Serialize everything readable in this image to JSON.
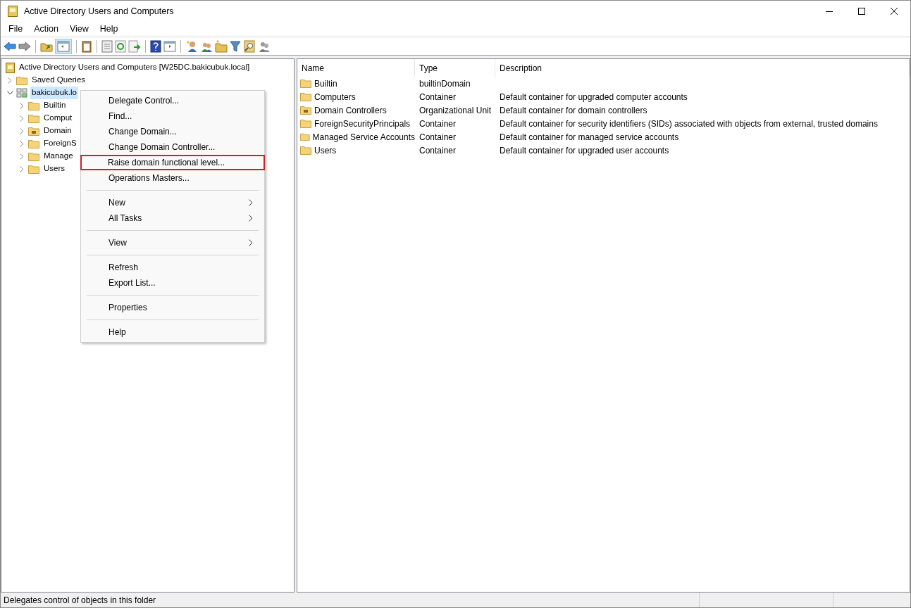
{
  "window": {
    "title": "Active Directory Users and Computers"
  },
  "menu_bar": [
    "File",
    "Action",
    "View",
    "Help"
  ],
  "tree": {
    "label": "Active Directory Users and Computers [W25DC.bakicubuk.local]",
    "children": [
      {
        "label": "Saved Queries",
        "kind": "folder",
        "expanded": false,
        "selected": false
      },
      {
        "label": "bakicubuk.lo",
        "kind": "domain",
        "expanded": true,
        "selected": true,
        "children": [
          {
            "label": "Builtin",
            "kind": "folder",
            "expanded": false,
            "selected": false
          },
          {
            "label": "Comput",
            "kind": "folder",
            "expanded": false,
            "selected": false
          },
          {
            "label": "Domain",
            "kind": "ou",
            "expanded": false,
            "selected": false
          },
          {
            "label": "ForeignS",
            "kind": "folder",
            "expanded": false,
            "selected": false
          },
          {
            "label": "Manage",
            "kind": "folder",
            "expanded": false,
            "selected": false
          },
          {
            "label": "Users",
            "kind": "folder",
            "expanded": false,
            "selected": false
          }
        ]
      }
    ]
  },
  "context_menu": [
    {
      "kind": "item",
      "label": "Delegate Control...",
      "submenu": false,
      "highlighted": false
    },
    {
      "kind": "item",
      "label": "Find...",
      "submenu": false,
      "highlighted": false
    },
    {
      "kind": "item",
      "label": "Change Domain...",
      "submenu": false,
      "highlighted": false
    },
    {
      "kind": "item",
      "label": "Change Domain Controller...",
      "submenu": false,
      "highlighted": false
    },
    {
      "kind": "item",
      "label": "Raise domain functional level...",
      "submenu": false,
      "highlighted": true
    },
    {
      "kind": "item",
      "label": "Operations Masters...",
      "submenu": false,
      "highlighted": false
    },
    {
      "kind": "separator"
    },
    {
      "kind": "item",
      "label": "New",
      "submenu": true,
      "highlighted": false
    },
    {
      "kind": "item",
      "label": "All Tasks",
      "submenu": true,
      "highlighted": false
    },
    {
      "kind": "separator"
    },
    {
      "kind": "item",
      "label": "View",
      "submenu": true,
      "highlighted": false
    },
    {
      "kind": "separator"
    },
    {
      "kind": "item",
      "label": "Refresh",
      "submenu": false,
      "highlighted": false
    },
    {
      "kind": "item",
      "label": "Export List...",
      "submenu": false,
      "highlighted": false
    },
    {
      "kind": "separator"
    },
    {
      "kind": "item",
      "label": "Properties",
      "submenu": false,
      "highlighted": false
    },
    {
      "kind": "separator"
    },
    {
      "kind": "item",
      "label": "Help",
      "submenu": false,
      "highlighted": false
    }
  ],
  "list": {
    "columns": [
      "Name",
      "Type",
      "Description"
    ],
    "rows": [
      {
        "kind": "folder",
        "name": "Builtin",
        "type": "builtinDomain",
        "description": ""
      },
      {
        "kind": "folder",
        "name": "Computers",
        "type": "Container",
        "description": "Default container for upgraded computer accounts"
      },
      {
        "kind": "ou",
        "name": "Domain Controllers",
        "type": "Organizational Unit",
        "description": "Default container for domain controllers"
      },
      {
        "kind": "folder",
        "name": "ForeignSecurityPrincipals",
        "type": "Container",
        "description": "Default container for security identifiers (SIDs) associated with objects from external, trusted domains"
      },
      {
        "kind": "folder",
        "name": "Managed Service Accounts",
        "type": "Container",
        "description": "Default container for managed service accounts"
      },
      {
        "kind": "folder",
        "name": "Users",
        "type": "Container",
        "description": "Default container for upgraded user accounts"
      }
    ]
  },
  "status_bar": "Delegates control of objects in this folder"
}
